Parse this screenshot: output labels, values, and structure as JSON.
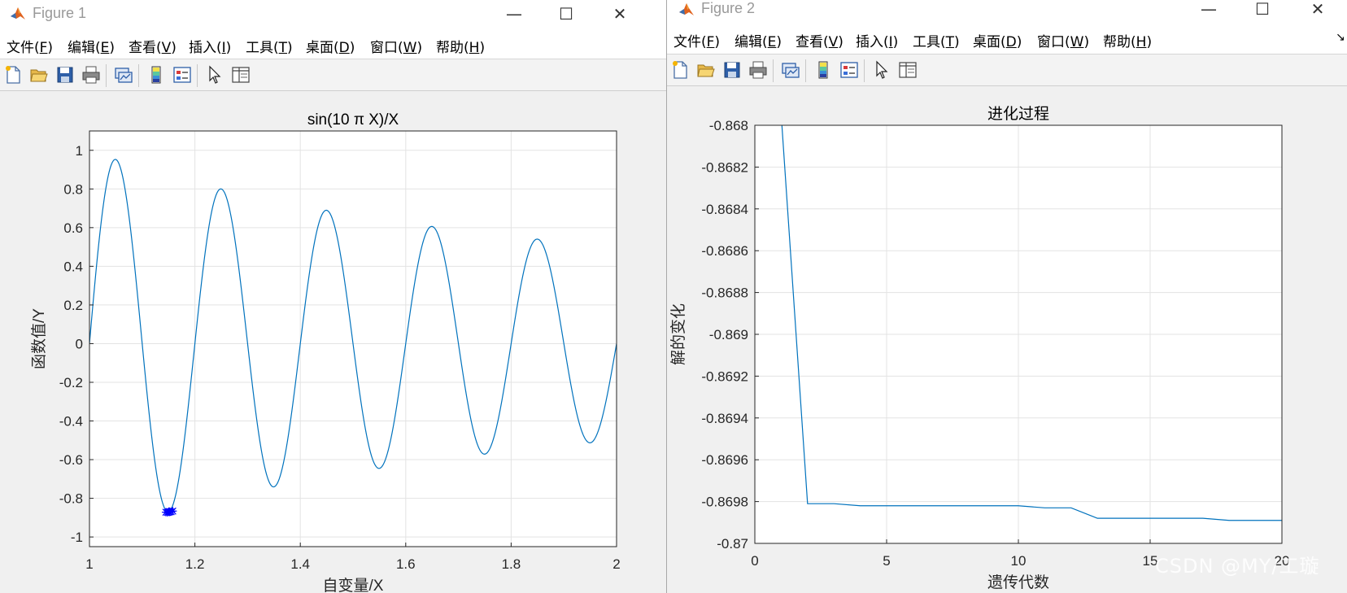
{
  "watermark": "CSDN @MY/工璇",
  "figure1": {
    "title": "Figure 1",
    "menus": [
      "文件(F)",
      "编辑(E)",
      "查看(V)",
      "插入(I)",
      "工具(T)",
      "桌面(D)",
      "窗口(W)",
      "帮助(H)"
    ],
    "menu_hotkeys": [
      "F",
      "E",
      "V",
      "I",
      "T",
      "D",
      "W",
      "H"
    ],
    "toolbar_icons": [
      "new-figure-icon",
      "open-file-icon",
      "save-icon",
      "print-icon",
      "link-plot-icon",
      "insert-colorbar-icon",
      "insert-legend-icon",
      "edit-plot-arrow-icon",
      "property-inspector-icon"
    ],
    "chart_data": {
      "type": "line",
      "title": "sin(10 π X)/X",
      "xlabel": "自变量/X",
      "ylabel": "函数值/Y",
      "xlim": [
        1,
        2
      ],
      "ylim": [
        -1.05,
        1.1
      ],
      "xticks": [
        1,
        1.2,
        1.4,
        1.6,
        1.8,
        2
      ],
      "xticklabels": [
        "1",
        "1.2",
        "1.4",
        "1.6",
        "1.8",
        "2"
      ],
      "yticks": [
        -1,
        -0.8,
        -0.6,
        -0.4,
        -0.2,
        0,
        0.2,
        0.4,
        0.6,
        0.8,
        1
      ],
      "yticklabels": [
        "-1",
        "-0.8",
        "-0.6",
        "-0.4",
        "-0.2",
        "0",
        "0.2",
        "0.4",
        "0.6",
        "0.8",
        "1"
      ],
      "grid": true,
      "function": "sin(10*pi*x)/x",
      "series_color": "#0072bd",
      "markers": {
        "color": "#0000ff",
        "points": [
          [
            1.145,
            -0.872
          ],
          [
            1.148,
            -0.873
          ],
          [
            1.15,
            -0.8698
          ],
          [
            1.152,
            -0.871
          ],
          [
            1.155,
            -0.8695
          ],
          [
            1.158,
            -0.866
          ],
          [
            1.151,
            -0.868
          ]
        ]
      }
    }
  },
  "figure2": {
    "title": "Figure 2",
    "menus": [
      "文件(F)",
      "编辑(E)",
      "查看(V)",
      "插入(I)",
      "工具(T)",
      "桌面(D)",
      "窗口(W)",
      "帮助(H)"
    ],
    "menu_hotkeys": [
      "F",
      "E",
      "V",
      "I",
      "T",
      "D",
      "W",
      "H"
    ],
    "toolbar_icons": [
      "new-figure-icon",
      "open-file-icon",
      "save-icon",
      "print-icon",
      "link-plot-icon",
      "insert-colorbar-icon",
      "insert-legend-icon",
      "edit-plot-arrow-icon",
      "property-inspector-icon"
    ],
    "chart_data": {
      "type": "line",
      "title": "进化过程",
      "xlabel": "遗传代数",
      "ylabel": "解的变化",
      "xlim": [
        0,
        20
      ],
      "ylim": [
        -0.87,
        -0.868
      ],
      "xticks": [
        0,
        5,
        10,
        15,
        20
      ],
      "xticklabels": [
        "0",
        "5",
        "10",
        "15",
        "20"
      ],
      "yticks": [
        -0.868,
        -0.8682,
        -0.8684,
        -0.8686,
        -0.8688,
        -0.869,
        -0.8692,
        -0.8694,
        -0.8696,
        -0.8698,
        -0.87
      ],
      "yticklabels": [
        "-0.868",
        "-0.8682",
        "-0.8684",
        "-0.8686",
        "-0.8688",
        "-0.869",
        "-0.8692",
        "-0.8694",
        "-0.8696",
        "-0.8698",
        "-0.87"
      ],
      "grid": true,
      "series_color": "#0072bd",
      "x": [
        1,
        2,
        3,
        4,
        5,
        6,
        7,
        8,
        9,
        10,
        11,
        12,
        13,
        14,
        15,
        16,
        17,
        18,
        19,
        20
      ],
      "y": [
        -0.86795,
        -0.86981,
        -0.86981,
        -0.86982,
        -0.86982,
        -0.86982,
        -0.86982,
        -0.86982,
        -0.86982,
        -0.86982,
        -0.86983,
        -0.86983,
        -0.86988,
        -0.86988,
        -0.86988,
        -0.86988,
        -0.86988,
        -0.86989,
        -0.86989,
        -0.86989
      ]
    }
  }
}
